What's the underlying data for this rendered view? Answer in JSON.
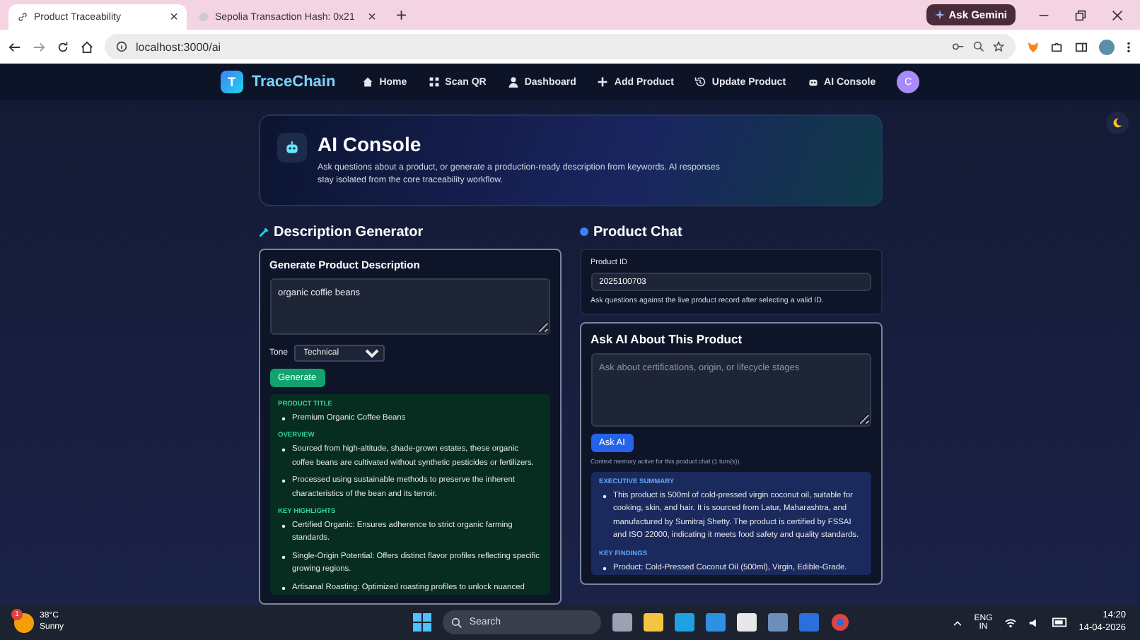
{
  "browser": {
    "tabs": [
      {
        "title": "Product Traceability",
        "selected": true
      },
      {
        "title": "Sepolia Transaction Hash: 0x21",
        "selected": false
      }
    ],
    "new_tab": "+",
    "close": "×",
    "address": "localhost:3000/ai",
    "gemini_button": "Ask Gemini"
  },
  "nav": {
    "logo_letter": "T",
    "brand": "TraceChain",
    "links": [
      {
        "label": "Home"
      },
      {
        "label": "Scan QR"
      },
      {
        "label": "Dashboard"
      },
      {
        "label": "Add Product"
      },
      {
        "label": "Update Product"
      },
      {
        "label": "AI Console"
      }
    ],
    "avatar": "C"
  },
  "hero": {
    "title": "AI Console",
    "description": "Ask questions about a product, or generate a production-ready description from keywords. AI responses stay isolated from the core traceability workflow."
  },
  "generator": {
    "heading": "Description Generator",
    "card_title": "Generate Product Description",
    "keywords": "organic coffie beans",
    "tone_label": "Tone",
    "tone": "Technical",
    "button": "Generate",
    "sections": [
      {
        "heading": "PRODUCT TITLE",
        "items": [
          "Premium Organic Coffee Beans"
        ]
      },
      {
        "heading": "OVERVIEW",
        "items": [
          "Sourced from high-altitude, shade-grown estates, these organic coffee beans are cultivated without synthetic pesticides or fertilizers.",
          "Processed using sustainable methods to preserve the inherent characteristics of the bean and its terroir."
        ]
      },
      {
        "heading": "KEY HIGHLIGHTS",
        "items": [
          "Certified Organic: Ensures adherence to strict organic farming standards.",
          "Single-Origin Potential: Offers distinct flavor profiles reflecting specific growing regions.",
          "Artisanal Roasting: Optimized roasting profiles to unlock nuanced"
        ]
      }
    ]
  },
  "chat": {
    "heading": "Product Chat",
    "product_id_label": "Product ID",
    "product_id": "2025100703",
    "hint": "Ask questions against the live product record after selecting a valid ID.",
    "ask_title": "Ask AI About This Product",
    "placeholder": "Ask about certifications, origin, or lifecycle stages",
    "button": "Ask AI",
    "memory_note": "Context memory active for this product chat (1 turn(s)).",
    "sections": [
      {
        "heading": "EXECUTIVE SUMMARY",
        "items": [
          "This product is 500ml of cold-pressed virgin coconut oil, suitable for cooking, skin, and hair. It is sourced from Latur, Maharashtra, and manufactured by Sumitraj Shetty. The product is certified by FSSAI and ISO 22000, indicating it meets food safety and quality standards."
        ]
      },
      {
        "heading": "KEY FINDINGS",
        "items": [
          "Product: Cold-Pressed Coconut Oil (500ml), Virgin, Edible-Grade."
        ]
      }
    ]
  },
  "taskbar": {
    "temperature": "38°C",
    "weather": "Sunny",
    "notification_count": "1",
    "search": "Search",
    "language": "ENG",
    "region": "IN",
    "time": "14:20",
    "date": "14-04-2026"
  }
}
